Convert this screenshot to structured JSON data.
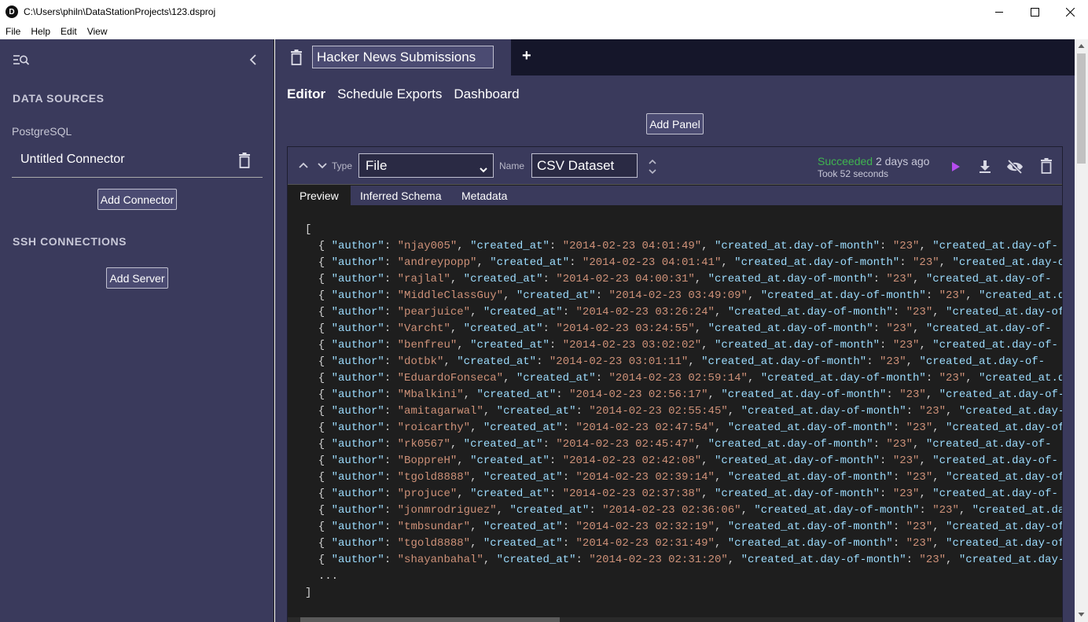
{
  "window": {
    "app_icon_letter": "D",
    "title": "C:\\Users\\philn\\DataStationProjects\\123.dsproj"
  },
  "menu": [
    "File",
    "Help",
    "Edit",
    "View"
  ],
  "sidebar": {
    "data_sources_title": "DATA SOURCES",
    "source_type": "PostgreSQL",
    "connector_name": "Untitled Connector",
    "add_connector_label": "Add Connector",
    "ssh_title": "SSH CONNECTIONS",
    "add_server_label": "Add Server"
  },
  "project": {
    "title_value": "Hacker News Submissions",
    "new_tab_label": "+"
  },
  "nav_tabs": [
    "Editor",
    "Schedule Exports",
    "Dashboard"
  ],
  "add_panel_label": "Add Panel",
  "panel": {
    "type_label": "Type",
    "type_value": "File",
    "name_label": "Name",
    "name_value": "CSV Dataset",
    "status_ok": "Succeeded",
    "status_when": "2 days ago",
    "duration": "Took 52 seconds",
    "result_tabs": [
      "Preview",
      "Inferred Schema",
      "Metadata"
    ]
  },
  "preview": {
    "open_bracket": "[",
    "close_bracket": "]",
    "ellipsis": "...",
    "key_author": "\"author\"",
    "key_created_at": "\"created_at\"",
    "key_dom": "\"created_at.day-of-month\"",
    "key_next": "\"created_at.day-of-",
    "dom_value": "\"23\"",
    "rows": [
      {
        "author": "\"njay005\"",
        "created_at": "\"2014-02-23 04:01:49\""
      },
      {
        "author": "\"andreypopp\"",
        "created_at": "\"2014-02-23 04:01:41\""
      },
      {
        "author": "\"rajlal\"",
        "created_at": "\"2014-02-23 04:00:31\""
      },
      {
        "author": "\"MiddleClassGuy\"",
        "created_at": "\"2014-02-23 03:49:09\""
      },
      {
        "author": "\"pearjuice\"",
        "created_at": "\"2014-02-23 03:26:24\""
      },
      {
        "author": "\"Varcht\"",
        "created_at": "\"2014-02-23 03:24:55\""
      },
      {
        "author": "\"benfreu\"",
        "created_at": "\"2014-02-23 03:02:02\""
      },
      {
        "author": "\"dotbk\"",
        "created_at": "\"2014-02-23 03:01:11\""
      },
      {
        "author": "\"EduardoFonseca\"",
        "created_at": "\"2014-02-23 02:59:14\""
      },
      {
        "author": "\"Mbalkini\"",
        "created_at": "\"2014-02-23 02:56:17\""
      },
      {
        "author": "\"amitagarwal\"",
        "created_at": "\"2014-02-23 02:55:45\""
      },
      {
        "author": "\"roicarthy\"",
        "created_at": "\"2014-02-23 02:47:54\""
      },
      {
        "author": "\"rk0567\"",
        "created_at": "\"2014-02-23 02:45:47\""
      },
      {
        "author": "\"BoppreH\"",
        "created_at": "\"2014-02-23 02:42:08\""
      },
      {
        "author": "\"tgold8888\"",
        "created_at": "\"2014-02-23 02:39:14\""
      },
      {
        "author": "\"projuce\"",
        "created_at": "\"2014-02-23 02:37:38\""
      },
      {
        "author": "\"jonmrodriguez\"",
        "created_at": "\"2014-02-23 02:36:06\""
      },
      {
        "author": "\"tmbsundar\"",
        "created_at": "\"2014-02-23 02:32:19\""
      },
      {
        "author": "\"tgold8888\"",
        "created_at": "\"2014-02-23 02:31:49\""
      },
      {
        "author": "\"shayanbahal\"",
        "created_at": "\"2014-02-23 02:31:20\""
      }
    ]
  },
  "colors": {
    "panel_bg": "#3a3a5c",
    "editor_bg": "#1e1e1e",
    "json_key": "#9cdcfe",
    "json_string": "#ce9178",
    "success": "#3fb44f",
    "run_accent": "#b54cf0"
  },
  "icons": {
    "app": "app-logo-icon",
    "sidebar_toggle": "list-search-icon",
    "collapse": "chevron-left-icon",
    "delete": "trash-icon",
    "move_up": "chevron-up-icon",
    "move_down": "chevron-down-icon",
    "resize": "resize-vertical-icon",
    "run": "play-icon",
    "download": "download-icon",
    "hide": "eye-off-icon"
  }
}
